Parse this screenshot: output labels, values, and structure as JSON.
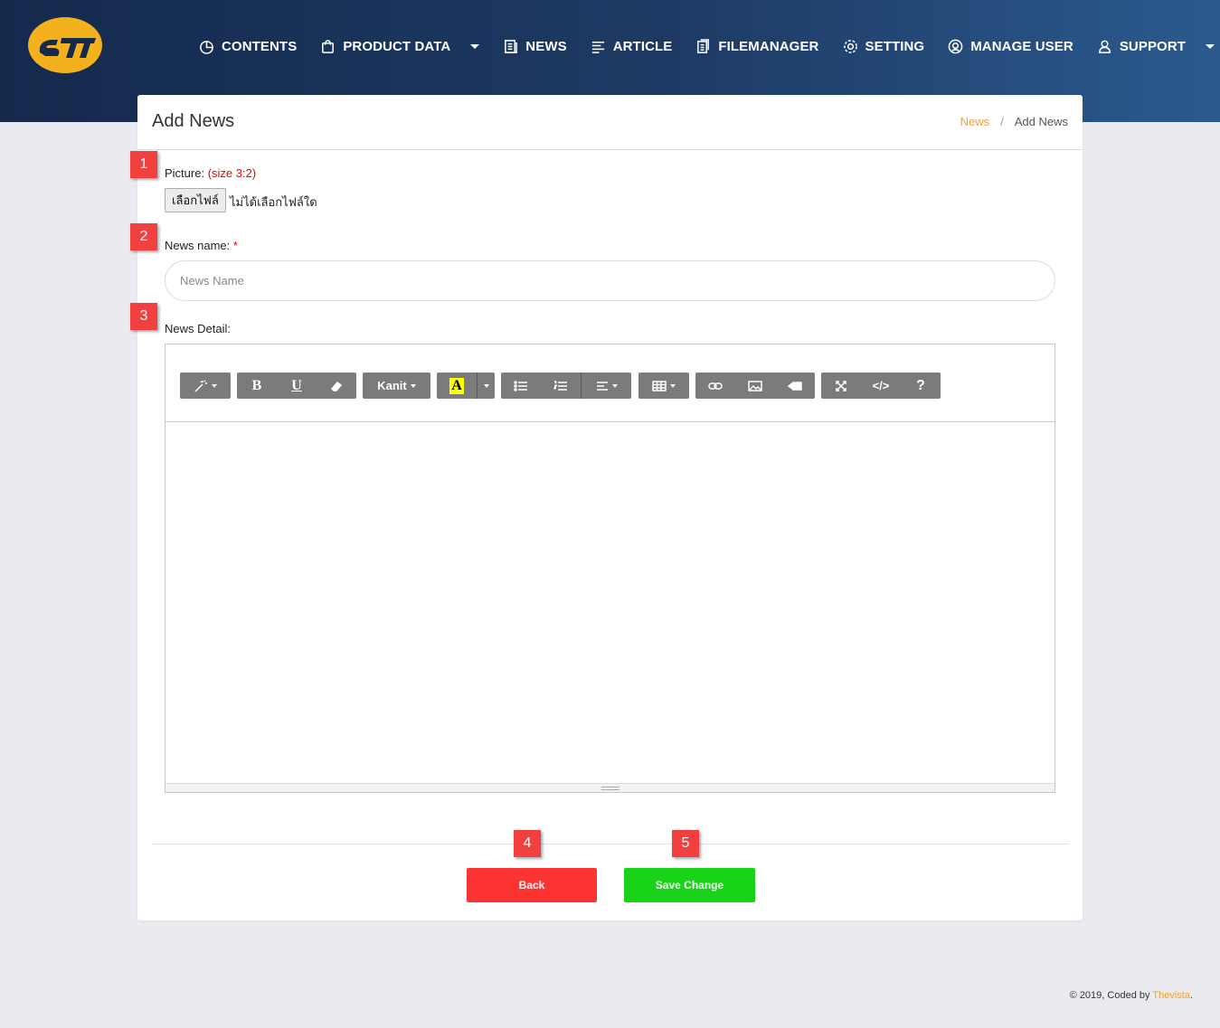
{
  "header": {
    "nav": [
      {
        "label": "CONTENTS",
        "icon": "pie-chart-icon",
        "dropdown": false
      },
      {
        "label": "PRODUCT DATA",
        "icon": "shopping-bag-icon",
        "dropdown": true
      },
      {
        "label": "NEWS",
        "icon": "newspaper-icon",
        "dropdown": false
      },
      {
        "label": "ARTICLE",
        "icon": "text-lines-icon",
        "dropdown": false
      },
      {
        "label": "FILEMANAGER",
        "icon": "document-icon",
        "dropdown": false
      },
      {
        "label": "SETTING",
        "icon": "gear-icon",
        "dropdown": false
      },
      {
        "label": "MANAGE USER",
        "icon": "user-circle-icon",
        "dropdown": false
      },
      {
        "label": "SUPPORT",
        "icon": "user-icon",
        "dropdown": true
      }
    ]
  },
  "page": {
    "title": "Add News",
    "breadcrumb": {
      "link": "News",
      "separator": "/",
      "current": "Add News"
    }
  },
  "form": {
    "picture": {
      "marker": "1",
      "label": "Picture:",
      "hint": "(size 3:2)",
      "button": "เลือกไฟล์",
      "status": "ไม่ได้เลือกไฟล์ใด"
    },
    "news_name": {
      "marker": "2",
      "label": "News name:",
      "required": "*",
      "placeholder": "News Name",
      "value": ""
    },
    "news_detail": {
      "marker": "3",
      "label": "News Detail:",
      "toolbar": {
        "font": "Kanit",
        "color_letter": "A",
        "help": "?",
        "code": "</>"
      }
    },
    "actions": {
      "back": {
        "marker": "4",
        "label": "Back"
      },
      "save": {
        "marker": "5",
        "label": "Save Change"
      }
    }
  },
  "colors": {
    "accent": "#f0a030",
    "back": "#fd3434",
    "save": "#18d318",
    "marker": "#f04040"
  },
  "footer": {
    "text": "© 2019, Coded by",
    "brand": "Thevista",
    "suffix": "."
  }
}
